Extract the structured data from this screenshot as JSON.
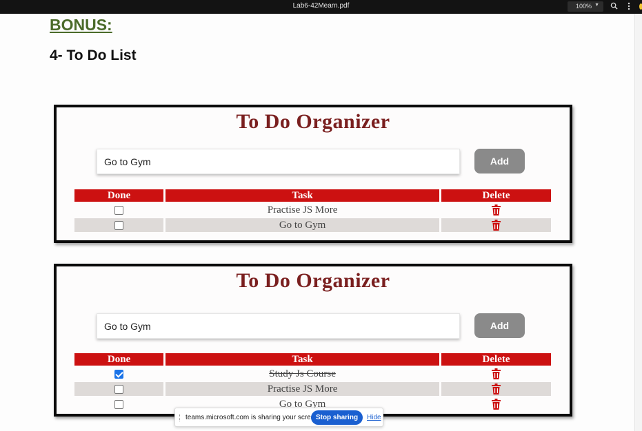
{
  "viewer": {
    "filename": "Lab6-42Mearn.pdf",
    "zoom": "100%",
    "icons": [
      "chevron-down-icon",
      "search-icon",
      "more-vertical-icon"
    ]
  },
  "document": {
    "bonus": "BONUS:",
    "heading": "4- To Do List"
  },
  "screenshot1": {
    "title": "To Do Organizer",
    "input_value": "Go to Gym",
    "add_label": "Add",
    "columns": [
      "Done",
      "Task",
      "Delete"
    ],
    "rows": [
      {
        "task": "Practise JS More",
        "done": false
      },
      {
        "task": "Go to Gym",
        "done": false
      }
    ]
  },
  "screenshot2": {
    "title": "To Do Organizer",
    "input_value": "Go to Gym",
    "add_label": "Add",
    "columns": [
      "Done",
      "Task",
      "Delete"
    ],
    "rows": [
      {
        "task": "Study Js Course",
        "done": true
      },
      {
        "task": "Practise JS More",
        "done": false
      },
      {
        "task": "Go to Gym",
        "done": false
      }
    ]
  },
  "sharing_bar": {
    "message": "teams.microsoft.com is sharing your screen.",
    "stop_label": "Stop sharing",
    "hide_label": "Hide"
  },
  "colors": {
    "header_red": "#cc1111",
    "title_maroon": "#7a1f1f",
    "trash_red": "#cc1111",
    "stop_blue": "#1a5fd0"
  }
}
